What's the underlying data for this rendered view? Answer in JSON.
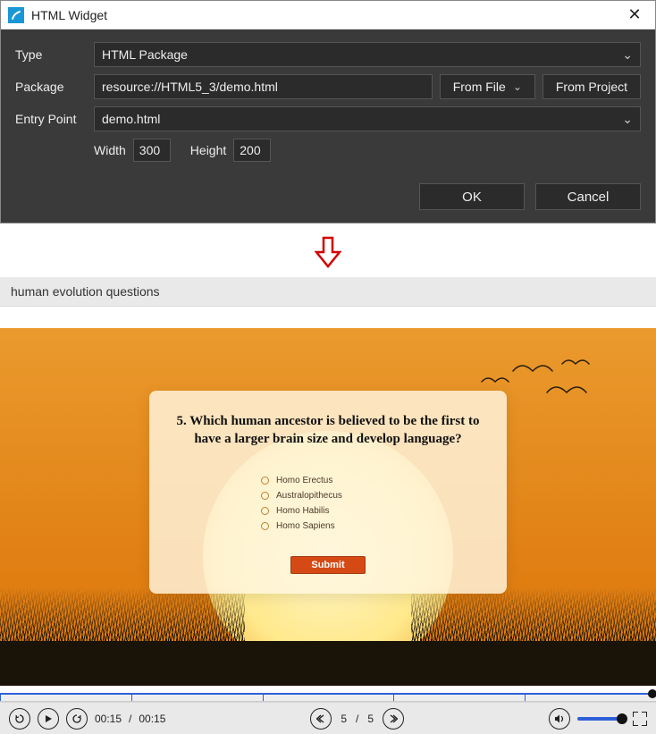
{
  "dialog": {
    "title": "HTML Widget",
    "labels": {
      "type": "Type",
      "package": "Package",
      "entry_point": "Entry Point",
      "width": "Width",
      "height": "Height"
    },
    "values": {
      "type": "HTML Package",
      "package": "resource://HTML5_3/demo.html",
      "entry_point": "demo.html",
      "width": "300",
      "height": "200"
    },
    "buttons": {
      "from_file": "From File",
      "from_project": "From Project",
      "ok": "OK",
      "cancel": "Cancel"
    }
  },
  "preview": {
    "header": "human evolution questions",
    "question": "5. Which human ancestor is believed to be the first to have a larger brain size and develop language?",
    "options": [
      "Homo Erectus",
      "Australopithecus",
      "Homo Habilis",
      "Homo Sapiens"
    ],
    "submit": "Submit"
  },
  "player": {
    "current_time": "00:15",
    "total_time": "00:15",
    "sep": "/",
    "page_current": "5",
    "page_sep": "/",
    "page_total": "5"
  }
}
